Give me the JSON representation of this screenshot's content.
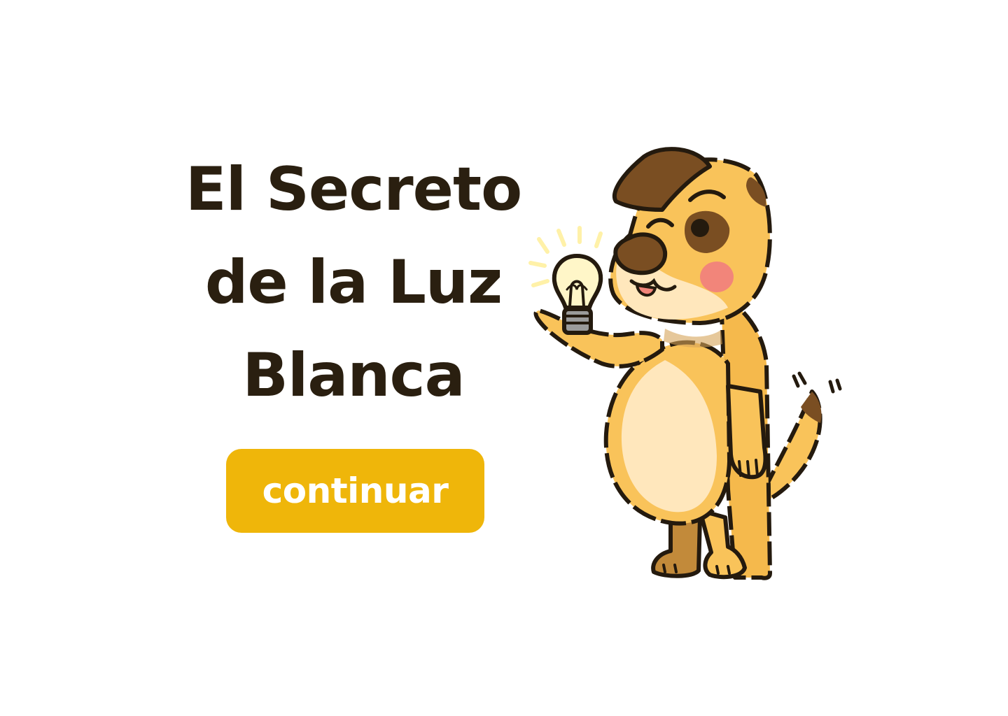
{
  "title": {
    "line1": "El Secreto",
    "line2": "de la Luz",
    "line3": "Blanca"
  },
  "continue_button": {
    "label": "continuar"
  },
  "colors": {
    "accent": "#EFB60A",
    "title_text": "#2a1f10",
    "button_text": "#ffffff",
    "dog_body": "#F9C35A",
    "dog_belly": "#FFE7BC",
    "dog_spots": "#7A4E22",
    "outline": "#241A0E",
    "cheek": "#F2857A",
    "bulb_glow": "#FFF4B8"
  },
  "illustration": {
    "icon": "dog-holding-lightbulb-illustration"
  }
}
